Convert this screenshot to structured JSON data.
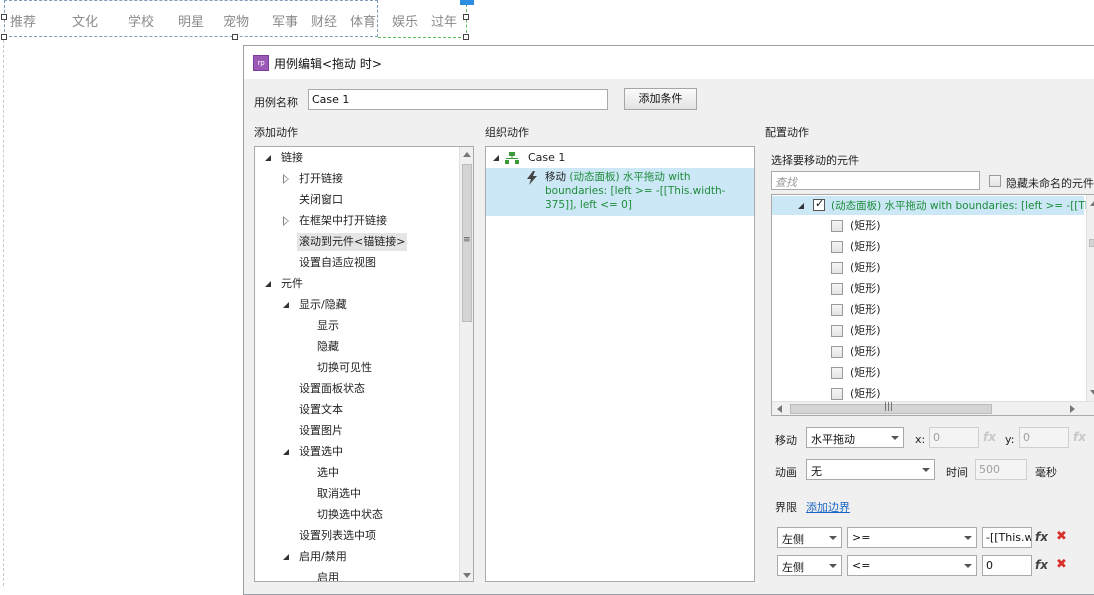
{
  "canvas": {
    "nav_items": [
      "推荐",
      "文化",
      "学校",
      "明星",
      "宠物",
      "军事",
      "财经",
      "体育",
      "娱乐",
      "过年"
    ]
  },
  "dialog": {
    "title": "用例编辑<拖动 时>",
    "case_name_label": "用例名称",
    "case_name_value": "Case 1",
    "add_condition_button": "添加条件",
    "add_actions_header": "添加动作",
    "organize_actions_header": "组织动作",
    "configure_actions_header": "配置动作"
  },
  "actions_tree": [
    {
      "label": "链接",
      "level": 0,
      "expander": "open"
    },
    {
      "label": "打开链接",
      "level": 1,
      "expander": "closed"
    },
    {
      "label": "关闭窗口",
      "level": 1,
      "expander": "none"
    },
    {
      "label": "在框架中打开链接",
      "level": 1,
      "expander": "closed"
    },
    {
      "label": "滚动到元件<锚链接>",
      "level": 1,
      "expander": "none",
      "highlight": true
    },
    {
      "label": "设置自适应视图",
      "level": 1,
      "expander": "none"
    },
    {
      "label": "元件",
      "level": 0,
      "expander": "open"
    },
    {
      "label": "显示/隐藏",
      "level": 1,
      "expander": "open"
    },
    {
      "label": "显示",
      "level": 2,
      "expander": "none"
    },
    {
      "label": "隐藏",
      "level": 2,
      "expander": "none"
    },
    {
      "label": "切换可见性",
      "level": 2,
      "expander": "none"
    },
    {
      "label": "设置面板状态",
      "level": 1,
      "expander": "none"
    },
    {
      "label": "设置文本",
      "level": 1,
      "expander": "none"
    },
    {
      "label": "设置图片",
      "level": 1,
      "expander": "none"
    },
    {
      "label": "设置选中",
      "level": 1,
      "expander": "open"
    },
    {
      "label": "选中",
      "level": 2,
      "expander": "none"
    },
    {
      "label": "取消选中",
      "level": 2,
      "expander": "none"
    },
    {
      "label": "切换选中状态",
      "level": 2,
      "expander": "none"
    },
    {
      "label": "设置列表选中项",
      "level": 1,
      "expander": "none"
    },
    {
      "label": "启用/禁用",
      "level": 1,
      "expander": "open"
    },
    {
      "label": "启用",
      "level": 2,
      "expander": "none"
    }
  ],
  "organize": {
    "case_label": "Case 1",
    "action_prefix": "移动",
    "action_target": "(动态面板)",
    "action_detail": "水平拖动 with boundaries: [left >= -[[This.width-375]], left <= 0]"
  },
  "configure": {
    "select_widget_label": "选择要移动的元件",
    "search_placeholder": "查找",
    "hide_unnamed_label": "隐藏未命名的元件",
    "widget_root_target": "(动态面板)",
    "widget_root_detail": "水平拖动 with boundaries: [left >= -[[This",
    "widget_children": [
      "(矩形)",
      "(矩形)",
      "(矩形)",
      "(矩形)",
      "(矩形)",
      "(矩形)",
      "(矩形)",
      "(矩形)",
      "(矩形)"
    ],
    "move_label": "移动",
    "move_value": "水平拖动",
    "x_label": "x:",
    "x_value": "0",
    "y_label": "y:",
    "y_value": "0",
    "fx_label": "fx",
    "anim_label": "动画",
    "anim_value": "无",
    "time_label": "时间",
    "time_value": "500",
    "ms_label": "毫秒",
    "bounds_label": "界限",
    "add_bound_link": "添加边界",
    "bounds": [
      {
        "side": "左侧",
        "op": ">=",
        "value": "-[[This.w"
      },
      {
        "side": "左侧",
        "op": "<=",
        "value": "0"
      }
    ],
    "delete_glyph": "✖"
  },
  "icons": {
    "app": "rp",
    "case": "case-tree-icon",
    "action": "lightning-icon"
  }
}
